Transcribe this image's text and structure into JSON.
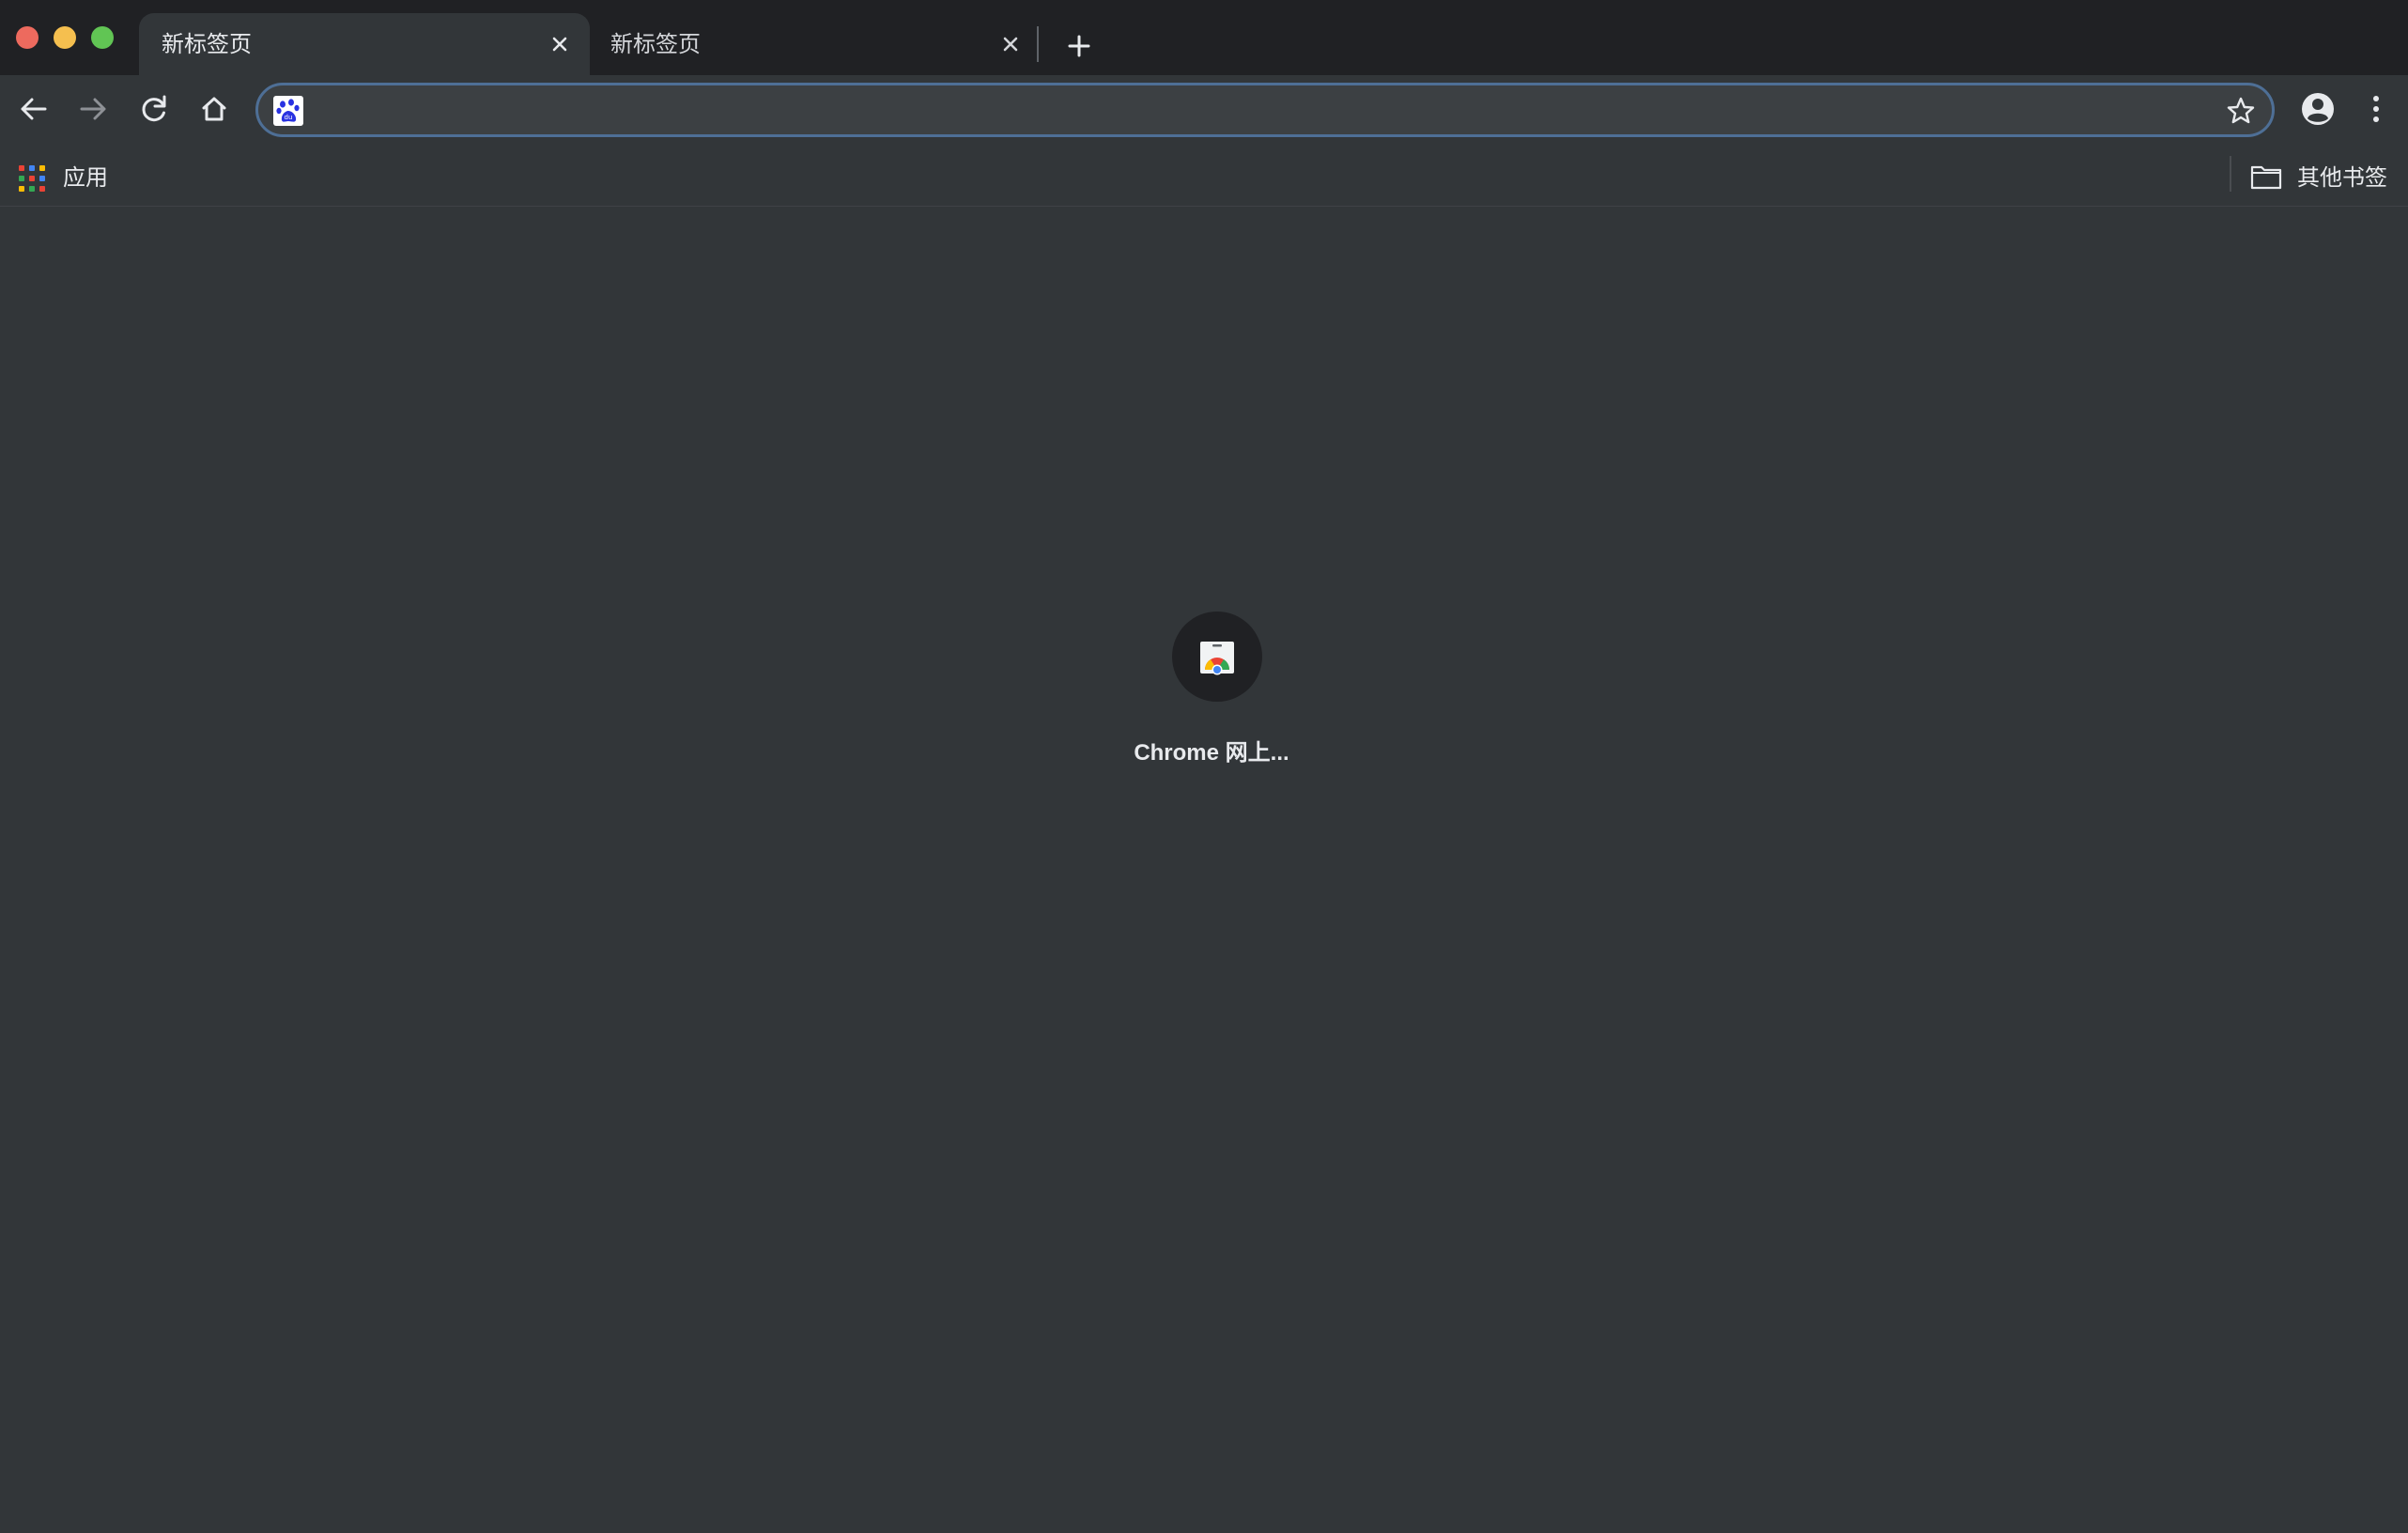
{
  "window": {
    "controls": [
      "close",
      "minimize",
      "maximize"
    ]
  },
  "tabs": [
    {
      "title": "新标签页",
      "active": true
    },
    {
      "title": "新标签页",
      "active": false
    }
  ],
  "toolbar": {
    "back_icon": "arrow-left-icon",
    "forward_icon": "arrow-right-icon",
    "reload_icon": "reload-icon",
    "home_icon": "home-icon",
    "omnibox": {
      "value": "",
      "placeholder": "",
      "search_engine_icon": "baidu-paw-icon"
    },
    "profile_icon": "account-circle-icon",
    "menu_icon": "more-vert-icon"
  },
  "bookmarks_bar": {
    "apps_label": "应用",
    "other_bookmarks_label": "其他书签"
  },
  "new_tab_page": {
    "shortcuts": [
      {
        "title": "Chrome 网上...",
        "icon": "chrome-web-store-icon"
      }
    ]
  },
  "colors": {
    "frame": "#202124",
    "toolbar": "#323639",
    "omnibox_bg": "#3c4043",
    "omnibox_focus_ring": "#4e6f96",
    "text": "#e8eaed"
  }
}
